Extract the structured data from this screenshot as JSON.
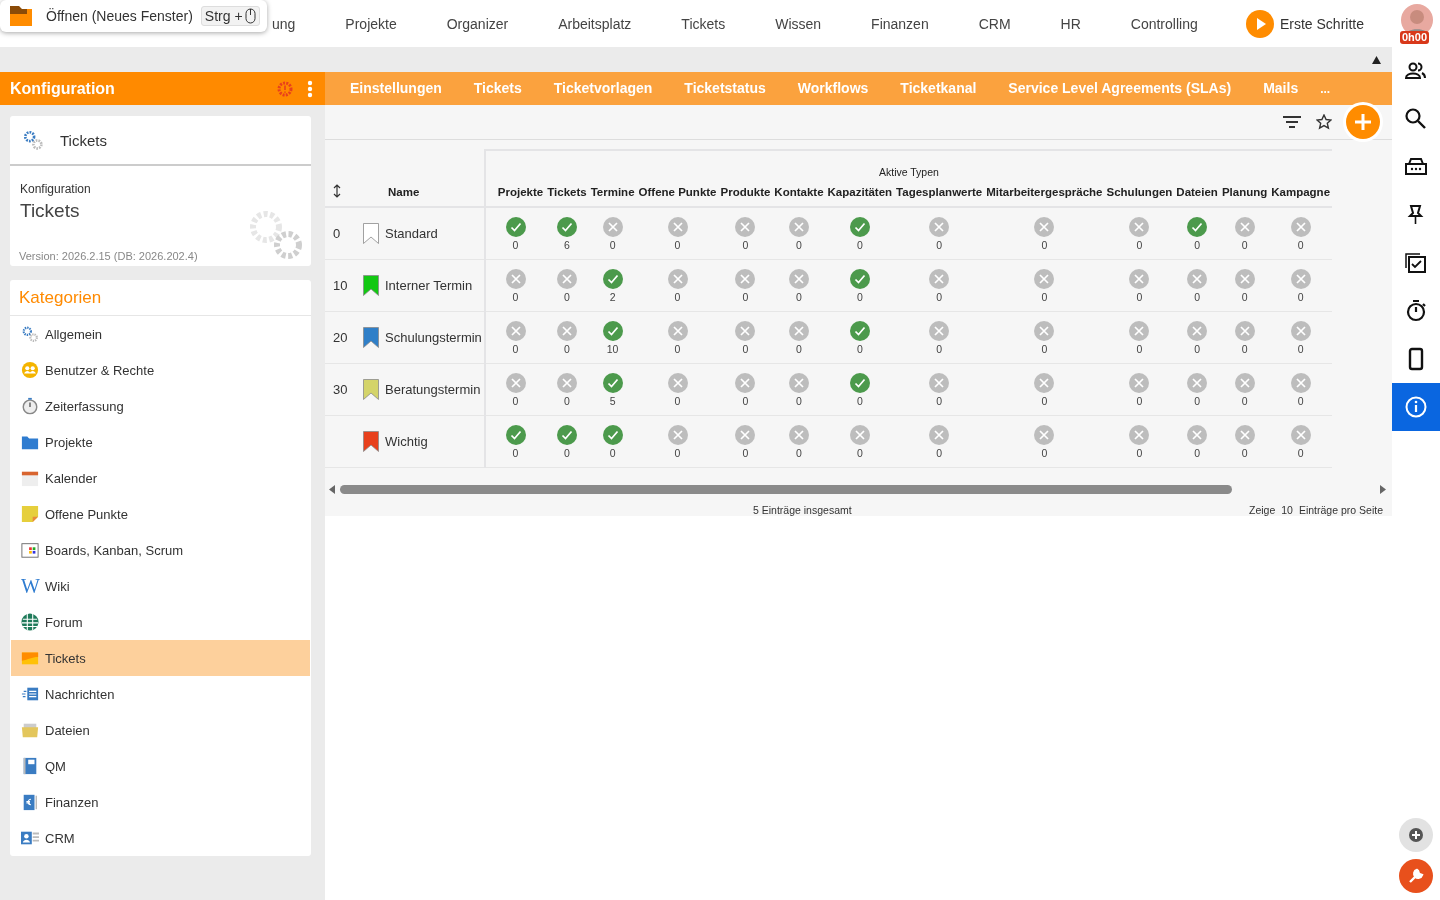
{
  "tooltip": {
    "text": "Öffnen (Neues Fenster)",
    "shortcut": "Strg +"
  },
  "top_nav": {
    "items": [
      "ung",
      "Projekte",
      "Organizer",
      "Arbeitsplatz",
      "Tickets",
      "Wissen",
      "Finanzen",
      "CRM",
      "HR",
      "Controlling"
    ],
    "start_button": "Erste Schritte",
    "avatar_badge": "0h00"
  },
  "sidebar": {
    "title": "Konfiguration",
    "module": {
      "title": "Tickets",
      "subtitle": "Konfiguration",
      "heading": "Tickets",
      "version": "Version: 2026.2.15 (DB: 2026.202.4)"
    },
    "categories_title": "Kategorien",
    "categories": [
      {
        "label": "Allgemein",
        "selected": false
      },
      {
        "label": "Benutzer & Rechte",
        "selected": false
      },
      {
        "label": "Zeiterfassung",
        "selected": false
      },
      {
        "label": "Projekte",
        "selected": false
      },
      {
        "label": "Kalender",
        "selected": false
      },
      {
        "label": "Offene Punkte",
        "selected": false
      },
      {
        "label": "Boards, Kanban, Scrum",
        "selected": false
      },
      {
        "label": "Wiki",
        "selected": false,
        "icon_text": "W"
      },
      {
        "label": "Forum",
        "selected": false
      },
      {
        "label": "Tickets",
        "selected": true
      },
      {
        "label": "Nachrichten",
        "selected": false
      },
      {
        "label": "Dateien",
        "selected": false
      },
      {
        "label": "QM",
        "selected": false
      },
      {
        "label": "Finanzen",
        "selected": false
      },
      {
        "label": "CRM",
        "selected": false
      }
    ]
  },
  "tabs": [
    {
      "label": "Einstellungen",
      "selected": false
    },
    {
      "label": "Tickets",
      "selected": false
    },
    {
      "label": "Ticketvorlagen",
      "selected": false
    },
    {
      "label": "Ticketstatus",
      "selected": false
    },
    {
      "label": "Workflows",
      "selected": false
    },
    {
      "label": "Ticketkanal",
      "selected": false
    },
    {
      "label": "Service Level Agreements (SLAs)",
      "selected": false
    },
    {
      "label": "Mails",
      "selected": false
    }
  ],
  "tabs_more": "...",
  "table": {
    "group_header": "Aktive Typen",
    "columns": [
      "",
      "Name",
      "Projekte",
      "Tickets",
      "Termine",
      "Offene Punkte",
      "Produkte",
      "Kontakte",
      "Kapazitäten",
      "Tagesplanwerte",
      "Mitarbeitergespräche",
      "Schulungen",
      "Dateien",
      "Planung",
      "Kampagne"
    ],
    "rows": [
      {
        "cells": [
          {
            "kind": "number",
            "text": "0"
          },
          {
            "kind": "name",
            "text": "Standard",
            "color": "#ffffff"
          },
          {
            "kind": "status",
            "active": true,
            "count": "0"
          },
          {
            "kind": "status",
            "active": true,
            "count": "6"
          },
          {
            "kind": "status",
            "active": false,
            "count": "0"
          },
          {
            "kind": "status",
            "active": false,
            "count": "0"
          },
          {
            "kind": "status",
            "active": false,
            "count": "0"
          },
          {
            "kind": "status",
            "active": false,
            "count": "0"
          },
          {
            "kind": "status",
            "active": true,
            "count": "0"
          },
          {
            "kind": "status",
            "active": false,
            "count": "0"
          },
          {
            "kind": "status",
            "active": false,
            "count": "0"
          },
          {
            "kind": "status",
            "active": false,
            "count": "0"
          },
          {
            "kind": "status",
            "active": true,
            "count": "0"
          },
          {
            "kind": "status",
            "active": false,
            "count": "0"
          },
          {
            "kind": "status",
            "active": false,
            "count": "0"
          }
        ]
      },
      {
        "cells": [
          {
            "kind": "number",
            "text": "10"
          },
          {
            "kind": "name",
            "text": "Interner Termin",
            "color": "#12c812"
          },
          {
            "kind": "status",
            "active": false,
            "count": "0"
          },
          {
            "kind": "status",
            "active": false,
            "count": "0"
          },
          {
            "kind": "status",
            "active": true,
            "count": "2"
          },
          {
            "kind": "status",
            "active": false,
            "count": "0"
          },
          {
            "kind": "status",
            "active": false,
            "count": "0"
          },
          {
            "kind": "status",
            "active": false,
            "count": "0"
          },
          {
            "kind": "status",
            "active": true,
            "count": "0"
          },
          {
            "kind": "status",
            "active": false,
            "count": "0"
          },
          {
            "kind": "status",
            "active": false,
            "count": "0"
          },
          {
            "kind": "status",
            "active": false,
            "count": "0"
          },
          {
            "kind": "status",
            "active": false,
            "count": "0"
          },
          {
            "kind": "status",
            "active": false,
            "count": "0"
          },
          {
            "kind": "status",
            "active": false,
            "count": "0"
          }
        ]
      },
      {
        "cells": [
          {
            "kind": "number",
            "text": "20"
          },
          {
            "kind": "name",
            "text": "Schulungstermin",
            "color": "#2f7fc8"
          },
          {
            "kind": "status",
            "active": false,
            "count": "0"
          },
          {
            "kind": "status",
            "active": false,
            "count": "0"
          },
          {
            "kind": "status",
            "active": true,
            "count": "10"
          },
          {
            "kind": "status",
            "active": false,
            "count": "0"
          },
          {
            "kind": "status",
            "active": false,
            "count": "0"
          },
          {
            "kind": "status",
            "active": false,
            "count": "0"
          },
          {
            "kind": "status",
            "active": true,
            "count": "0"
          },
          {
            "kind": "status",
            "active": false,
            "count": "0"
          },
          {
            "kind": "status",
            "active": false,
            "count": "0"
          },
          {
            "kind": "status",
            "active": false,
            "count": "0"
          },
          {
            "kind": "status",
            "active": false,
            "count": "0"
          },
          {
            "kind": "status",
            "active": false,
            "count": "0"
          },
          {
            "kind": "status",
            "active": false,
            "count": "0"
          }
        ]
      },
      {
        "cells": [
          {
            "kind": "number",
            "text": "30"
          },
          {
            "kind": "name",
            "text": "Beratungstermin",
            "color": "#d4d46a"
          },
          {
            "kind": "status",
            "active": false,
            "count": "0"
          },
          {
            "kind": "status",
            "active": false,
            "count": "0"
          },
          {
            "kind": "status",
            "active": true,
            "count": "5"
          },
          {
            "kind": "status",
            "active": false,
            "count": "0"
          },
          {
            "kind": "status",
            "active": false,
            "count": "0"
          },
          {
            "kind": "status",
            "active": false,
            "count": "0"
          },
          {
            "kind": "status",
            "active": true,
            "count": "0"
          },
          {
            "kind": "status",
            "active": false,
            "count": "0"
          },
          {
            "kind": "status",
            "active": false,
            "count": "0"
          },
          {
            "kind": "status",
            "active": false,
            "count": "0"
          },
          {
            "kind": "status",
            "active": false,
            "count": "0"
          },
          {
            "kind": "status",
            "active": false,
            "count": "0"
          },
          {
            "kind": "status",
            "active": false,
            "count": "0"
          }
        ]
      },
      {
        "cells": [
          {
            "kind": "number",
            "text": ""
          },
          {
            "kind": "name",
            "text": "Wichtig",
            "color": "#e8401c"
          },
          {
            "kind": "status",
            "active": true,
            "count": "0"
          },
          {
            "kind": "status",
            "active": true,
            "count": "0"
          },
          {
            "kind": "status",
            "active": true,
            "count": "0"
          },
          {
            "kind": "status",
            "active": false,
            "count": "0"
          },
          {
            "kind": "status",
            "active": false,
            "count": "0"
          },
          {
            "kind": "status",
            "active": false,
            "count": "0"
          },
          {
            "kind": "status",
            "active": false,
            "count": "0"
          },
          {
            "kind": "status",
            "active": false,
            "count": "0"
          },
          {
            "kind": "status",
            "active": false,
            "count": "0"
          },
          {
            "kind": "status",
            "active": false,
            "count": "0"
          },
          {
            "kind": "status",
            "active": false,
            "count": "0"
          },
          {
            "kind": "status",
            "active": false,
            "count": "0"
          },
          {
            "kind": "status",
            "active": false,
            "count": "0"
          }
        ]
      }
    ]
  },
  "footer": {
    "total": "5 Einträge insgesamt",
    "page_size_label": "Zeige",
    "page_size": "10",
    "page_size_suffix": "Einträge pro Seite"
  },
  "right_rail": {
    "buttons": [
      {
        "selected": false
      },
      {
        "selected": false
      },
      {
        "selected": false
      },
      {
        "selected": false
      },
      {
        "selected": false
      },
      {
        "selected": false
      },
      {
        "selected": false
      },
      {
        "selected": true
      }
    ]
  }
}
